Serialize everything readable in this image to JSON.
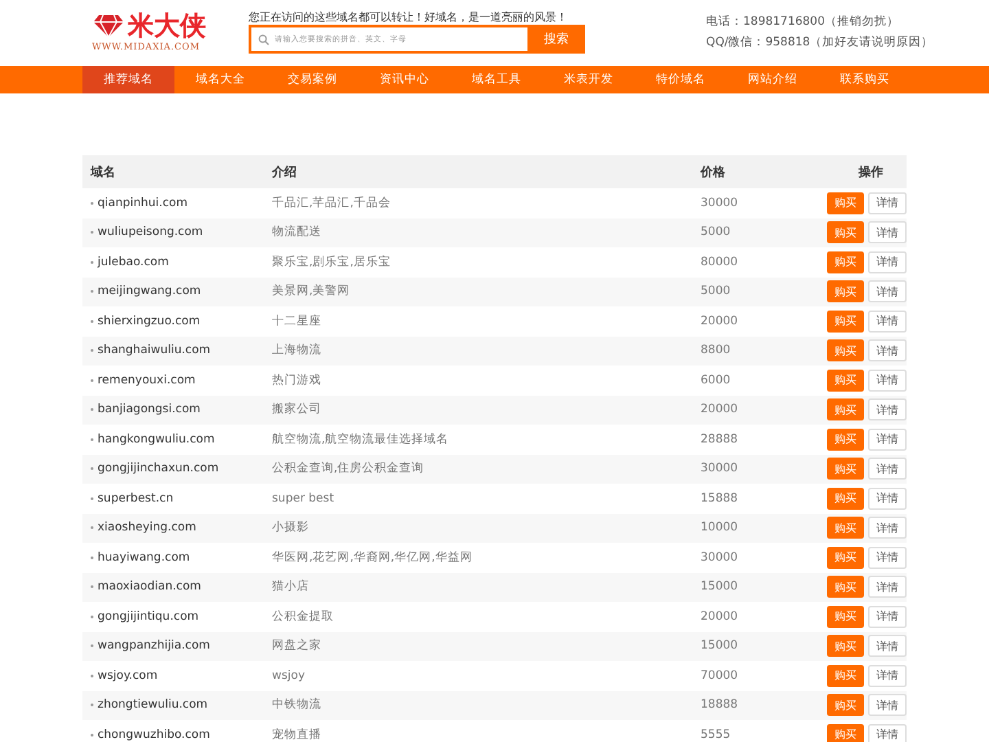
{
  "logo": {
    "name": "米大侠",
    "url": "WWW.MIDAXIA.COM"
  },
  "slogan": "您正在访问的这些域名都可以转让！好域名，是一道亮丽的风景！",
  "search": {
    "placeholder": "请输入您要搜索的拼音、英文、字母",
    "button": "搜索"
  },
  "contact": [
    "电话：18981716800（推销勿扰）",
    "QQ/微信：958818（加好友请说明原因）"
  ],
  "nav": [
    {
      "label": "推荐域名",
      "selected": true
    },
    {
      "label": "域名大全",
      "selected": false
    },
    {
      "label": "交易案例",
      "selected": false
    },
    {
      "label": "资讯中心",
      "selected": false
    },
    {
      "label": "域名工具",
      "selected": false
    },
    {
      "label": "米表开发",
      "selected": false
    },
    {
      "label": "特价域名",
      "selected": false
    },
    {
      "label": "网站介绍",
      "selected": false
    },
    {
      "label": "联系购买",
      "selected": false
    }
  ],
  "table": {
    "columns": [
      "域名",
      "介绍",
      "价格",
      "操作"
    ],
    "rows": [
      {
        "domain": "qianpinhui.com",
        "intro": "千品汇,芊品汇,千品会",
        "price": "30000",
        "buy": "购买",
        "detail": "详情"
      },
      {
        "domain": "wuliupeisong.com",
        "intro": "物流配送",
        "price": "5000",
        "buy": "购买",
        "detail": "详情"
      },
      {
        "domain": "julebao.com",
        "intro": "聚乐宝,剧乐宝,居乐宝",
        "price": "80000",
        "buy": "购买",
        "detail": "详情"
      },
      {
        "domain": "meijingwang.com",
        "intro": "美景网,美警网",
        "price": "5000",
        "buy": "购买",
        "detail": "详情"
      },
      {
        "domain": "shierxingzuo.com",
        "intro": "十二星座",
        "price": "20000",
        "buy": "购买",
        "detail": "详情"
      },
      {
        "domain": "shanghaiwuliu.com",
        "intro": "上海物流",
        "price": "8800",
        "buy": "购买",
        "detail": "详情"
      },
      {
        "domain": "remenyouxi.com",
        "intro": "热门游戏",
        "price": "6000",
        "buy": "购买",
        "detail": "详情"
      },
      {
        "domain": "banjiagongsi.com",
        "intro": "搬家公司",
        "price": "20000",
        "buy": "购买",
        "detail": "详情"
      },
      {
        "domain": "hangkongwuliu.com",
        "intro": "航空物流,航空物流最佳选择域名",
        "price": "28888",
        "buy": "购买",
        "detail": "详情"
      },
      {
        "domain": "gongjijinchaxun.com",
        "intro": "公积金查询,住房公积金查询",
        "price": "30000",
        "buy": "购买",
        "detail": "详情"
      },
      {
        "domain": "superbest.cn",
        "intro": "super best",
        "price": "15888",
        "buy": "购买",
        "detail": "详情"
      },
      {
        "domain": "xiaosheying.com",
        "intro": "小摄影",
        "price": "10000",
        "buy": "购买",
        "detail": "详情"
      },
      {
        "domain": "huayiwang.com",
        "intro": "华医网,花艺网,华裔网,华亿网,华益网",
        "price": "30000",
        "buy": "购买",
        "detail": "详情"
      },
      {
        "domain": "maoxiaodian.com",
        "intro": "猫小店",
        "price": "15000",
        "buy": "购买",
        "detail": "详情"
      },
      {
        "domain": "gongjijintiqu.com",
        "intro": "公积金提取",
        "price": "20000",
        "buy": "购买",
        "detail": "详情"
      },
      {
        "domain": "wangpanzhijia.com",
        "intro": "网盘之家",
        "price": "15000",
        "buy": "购买",
        "detail": "详情"
      },
      {
        "domain": "wsjoy.com",
        "intro": "wsjoy",
        "price": "70000",
        "buy": "购买",
        "detail": "详情"
      },
      {
        "domain": "zhongtiewuliu.com",
        "intro": "中铁物流",
        "price": "18888",
        "buy": "购买",
        "detail": "详情"
      },
      {
        "domain": "chongwuzhibo.com",
        "intro": "宠物直播",
        "price": "5555",
        "buy": "购买",
        "detail": "详情"
      }
    ]
  }
}
